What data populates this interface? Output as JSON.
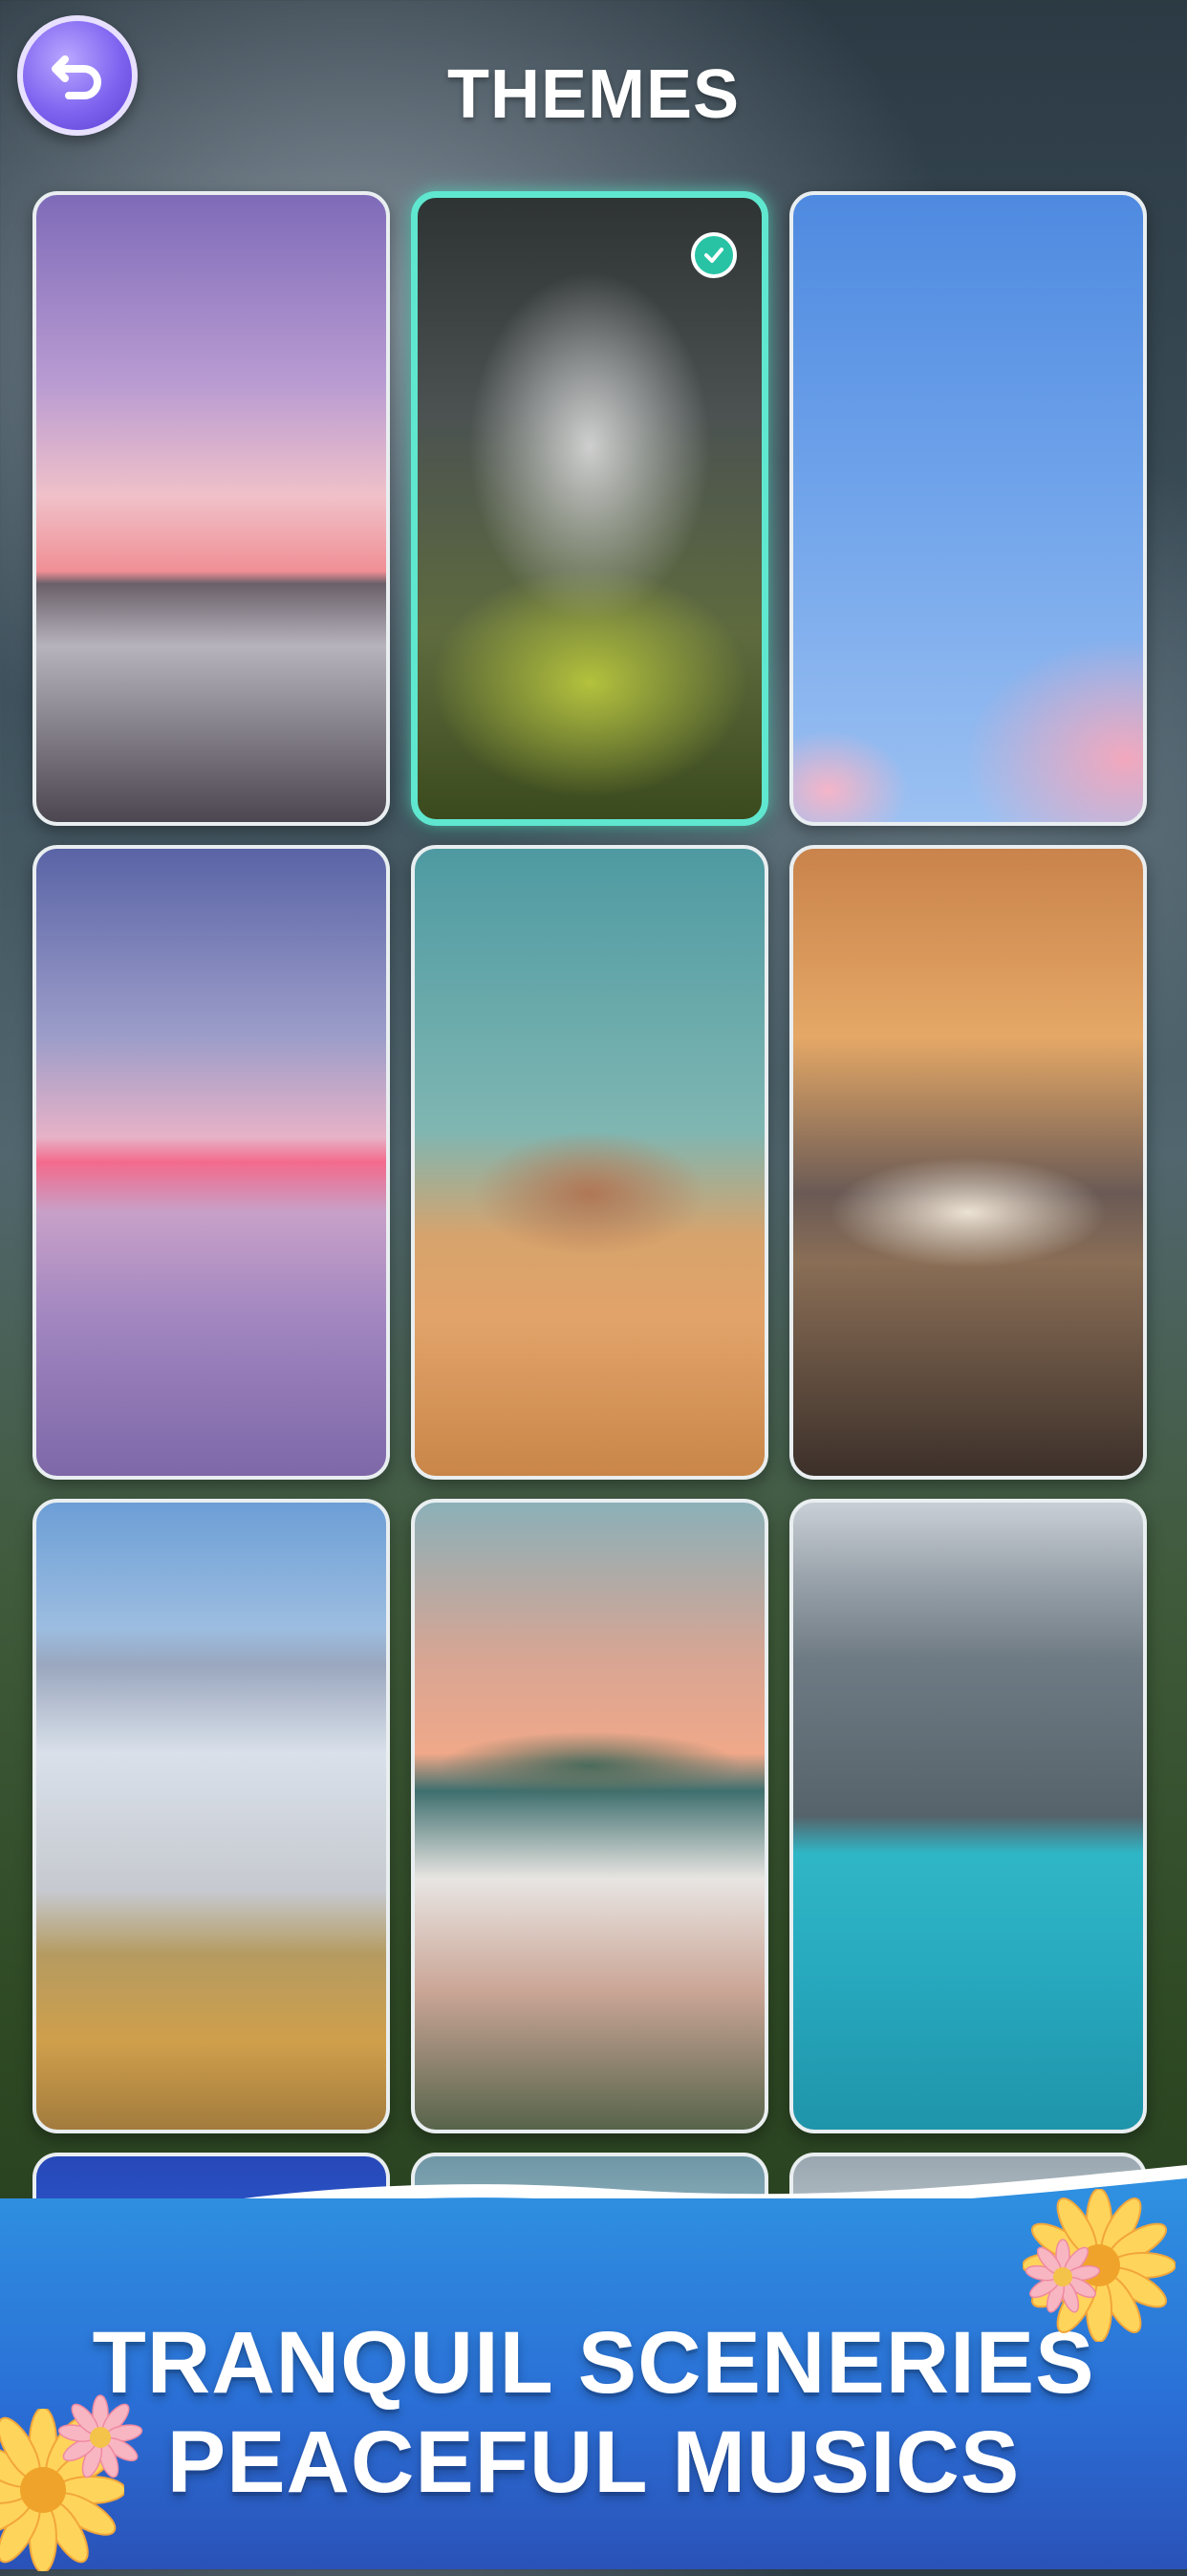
{
  "header": {
    "title": "THEMES",
    "back_icon": "undo-arrow-icon"
  },
  "themes": {
    "selected_index": 1,
    "items": [
      {
        "scene": "mountain-sunset"
      },
      {
        "scene": "volcanic-steam"
      },
      {
        "scene": "cherry-blossom-sky"
      },
      {
        "scene": "sea-of-clouds"
      },
      {
        "scene": "desert-rock"
      },
      {
        "scene": "mosque-dusk"
      },
      {
        "scene": "salt-lake"
      },
      {
        "scene": "hillside-village"
      },
      {
        "scene": "turquoise-lake-forest"
      }
    ]
  },
  "promo": {
    "line1": "TRANQUIL SCENERIES",
    "line2": "PEACEFUL MUSICS"
  },
  "colors": {
    "accent_selected": "#5fe7cf",
    "check_badge": "#28c3a5",
    "back_button": "#7f64f0",
    "banner_blue": "#2a6fd6"
  }
}
